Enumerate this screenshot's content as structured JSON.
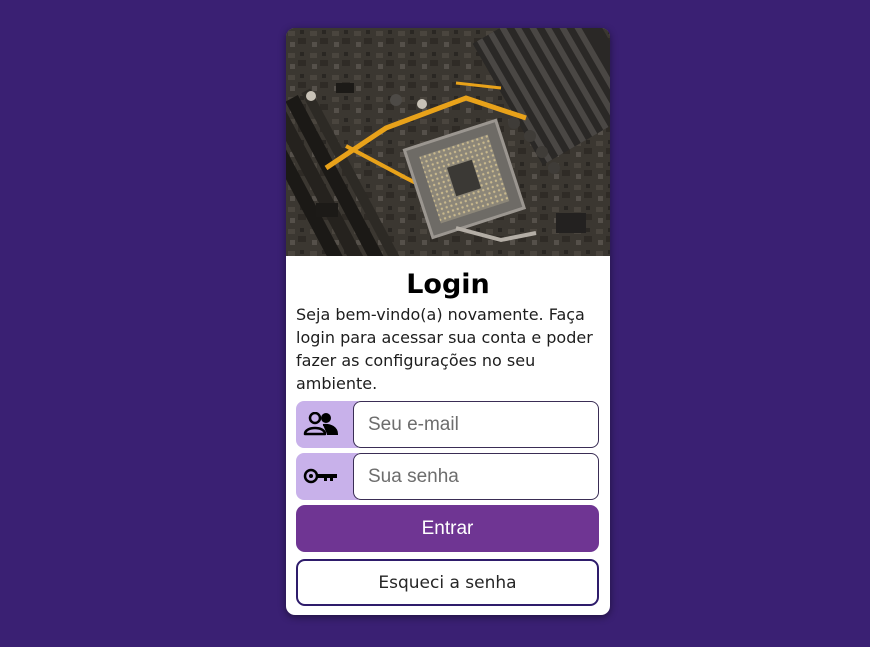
{
  "login": {
    "title": "Login",
    "intro": "Seja bem-vindo(a) novamente. Faça login para acessar sua conta e poder fazer as configurações no seu ambiente.",
    "email": {
      "placeholder": "Seu e-mail",
      "icon": "users-icon"
    },
    "password": {
      "placeholder": "Sua senha",
      "icon": "key-icon"
    },
    "submit_label": "Entrar",
    "forgot_label": "Esqueci a senha"
  },
  "colors": {
    "page_background": "#3a2073",
    "card_background": "#ffffff",
    "primary_button": "#6f3593",
    "icon_background": "#c8b1ea",
    "outline": "#2e1c6b"
  }
}
